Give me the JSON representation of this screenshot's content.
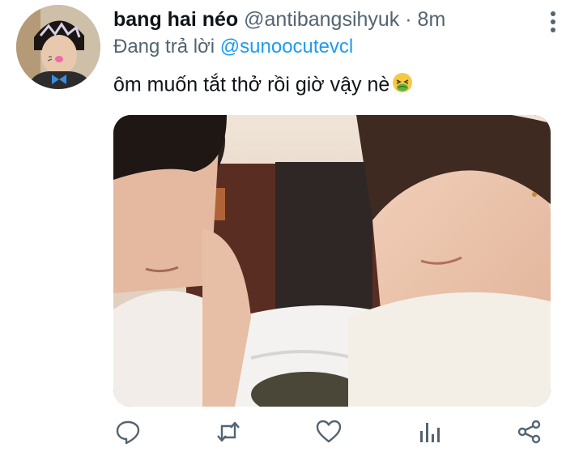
{
  "tweet": {
    "display_name": "bang hai néo",
    "handle": "@antibangsihyuk",
    "separator": "·",
    "time": "8m",
    "reply_prefix": "Đang trả lời",
    "reply_to": "@sunoocutevcl",
    "text": "ôm muốn tắt thở rồi giờ vậy nè"
  },
  "icons": {
    "more": "vertical-ellipsis-icon",
    "emoji": "nauseated-face-emoji",
    "actions": [
      "reply-icon",
      "retweet-icon",
      "like-icon",
      "analytics-icon",
      "share-icon"
    ]
  },
  "colors": {
    "link": "#1d9bf0",
    "secondary_text": "#536471",
    "primary_text": "#0f1419",
    "icon": "#536471"
  }
}
